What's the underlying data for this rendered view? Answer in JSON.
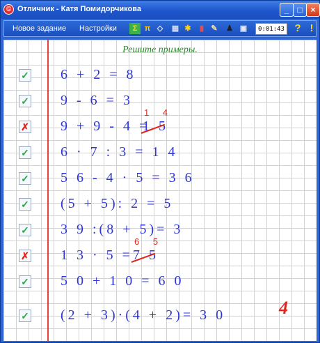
{
  "window": {
    "title": "Отличник - Катя Помидорчикова",
    "app_icon": "app-icon"
  },
  "toolbar": {
    "new_task": "Новое задание",
    "settings": "Настройки",
    "timer": "0:01:43",
    "icons": [
      "sum-icon",
      "pi-icon",
      "eraser-icon",
      "calendar-icon",
      "bulb-icon",
      "book-icon",
      "pencil-icon",
      "people-icon",
      "printer-icon"
    ],
    "help": "?",
    "alert": "!"
  },
  "content": {
    "heading": "Решите примеры.",
    "rows": [
      {
        "status": "correct",
        "expression": "6 + 2 = 8"
      },
      {
        "status": "correct",
        "expression": "9 - 6 = 3"
      },
      {
        "status": "wrong",
        "expression": "9 + 9 - 4 =",
        "given": "1 5",
        "correction": "1 4"
      },
      {
        "status": "correct",
        "expression": "6 · 7 : 3 = 1 4"
      },
      {
        "status": "correct",
        "expression": "5 6 - 4 · 5 = 3 6"
      },
      {
        "status": "correct",
        "expression": "(5 + 5): 2 = 5"
      },
      {
        "status": "correct",
        "expression": "3 9 :(8 + 5)= 3"
      },
      {
        "status": "wrong",
        "expression": "1 3 · 5 =",
        "given": "7 5",
        "correction": "6 5"
      },
      {
        "status": "correct",
        "expression": "5 0 + 1 0 = 6 0"
      },
      {
        "status": "correct",
        "expression": "(2 + 3)·(4 + 2)= 3 0"
      }
    ],
    "grade": "4"
  },
  "colors": {
    "titlebar": "#1f56cc",
    "margin": "#e8413c",
    "ink": "#2f36d6",
    "correct": "#2aa84a",
    "wrong": "#e0261c",
    "heading": "#2f8a2f"
  }
}
